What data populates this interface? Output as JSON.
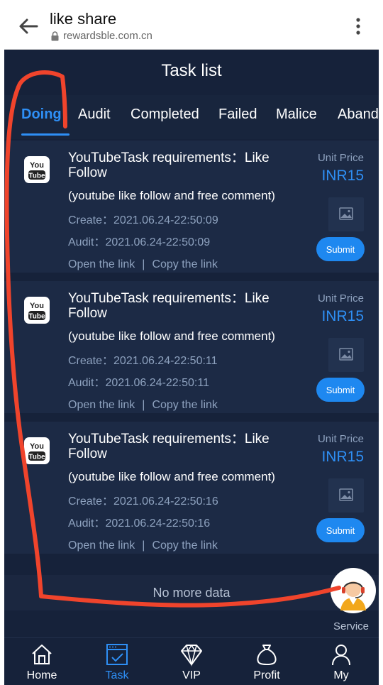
{
  "browser": {
    "title": "like share",
    "url": "rewardsble.com.cn"
  },
  "header": {
    "title": "Task list"
  },
  "tabs": [
    {
      "label": "Doing",
      "active": true
    },
    {
      "label": "Audit"
    },
    {
      "label": "Completed"
    },
    {
      "label": "Failed"
    },
    {
      "label": "Malice"
    },
    {
      "label": "Aband"
    }
  ],
  "tasks": [
    {
      "logo": "youtube-icon",
      "title": "YouTubeTask requirements：Like Follow",
      "description": "(youtube like follow and free comment)",
      "create": "Create：2021.06.24-22:50:09",
      "audit": "Audit：2021.06.24-22:50:09",
      "open_link": "Open the link",
      "separator": "|",
      "copy_link": "Copy the link",
      "unit_price_label": "Unit Price",
      "price": "INR15",
      "submit_label": "Submit"
    },
    {
      "logo": "youtube-icon",
      "title": "YouTubeTask requirements：Like Follow",
      "description": "(youtube like follow and free comment)",
      "create": "Create：2021.06.24-22:50:11",
      "audit": "Audit：2021.06.24-22:50:11",
      "open_link": "Open the link",
      "separator": "|",
      "copy_link": "Copy the link",
      "unit_price_label": "Unit Price",
      "price": "INR15",
      "submit_label": "Submit"
    },
    {
      "logo": "youtube-icon",
      "title": "YouTubeTask requirements：Like Follow",
      "description": "(youtube like follow and free comment)",
      "create": "Create：2021.06.24-22:50:16",
      "audit": "Audit：2021.06.24-22:50:16",
      "open_link": "Open the link",
      "separator": "|",
      "copy_link": "Copy the link",
      "unit_price_label": "Unit Price",
      "price": "INR15",
      "submit_label": "Submit"
    }
  ],
  "no_more_text": "No more data",
  "service_label": "Service",
  "nav": [
    {
      "label": "Home",
      "icon": "home-icon"
    },
    {
      "label": "Task",
      "icon": "task-icon",
      "active": true
    },
    {
      "label": "VIP",
      "icon": "diamond-icon"
    },
    {
      "label": "Profit",
      "icon": "money-bag-icon"
    },
    {
      "label": "My",
      "icon": "user-icon"
    }
  ],
  "colors": {
    "background": "#16223a",
    "card": "#1c2a45",
    "accent": "#2e8ff5",
    "muted_text": "#8ea2bf",
    "annotation": "#f0442c"
  }
}
